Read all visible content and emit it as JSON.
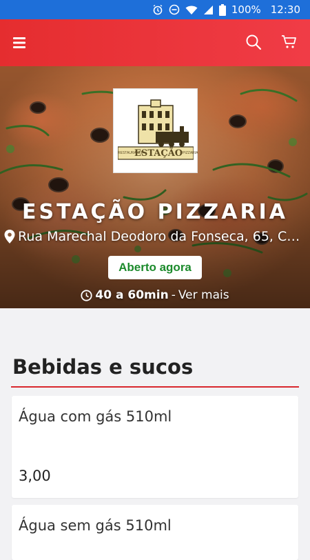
{
  "status_bar": {
    "battery": "100%",
    "time": "12:30",
    "icons": [
      "alarm-icon",
      "do-not-disturb-icon",
      "wifi-icon",
      "signal-icon",
      "battery-icon"
    ]
  },
  "app_bar": {
    "icons": [
      "menu-icon",
      "search-icon",
      "cart-icon"
    ],
    "color": "#e8323a"
  },
  "restaurant": {
    "logo": {
      "name": "ESTAÇÃO",
      "left_text": "RESTAURANTE",
      "right_text": "PIZZARIA"
    },
    "name": "ESTAÇÃO PIZZARIA",
    "address": "Rua Marechal Deodoro da Fonseca, 65, C…",
    "status": "Aberto agora",
    "status_color": "#1b8a2b",
    "delivery_time": "40 a 60min",
    "see_more": "Ver mais"
  },
  "menu": {
    "category": "Bebidas e sucos",
    "accent": "#d8262c",
    "items": [
      {
        "name": "Água com gás 510ml",
        "price": "3,00"
      },
      {
        "name": "Água sem gás 510ml",
        "price": ""
      }
    ]
  }
}
